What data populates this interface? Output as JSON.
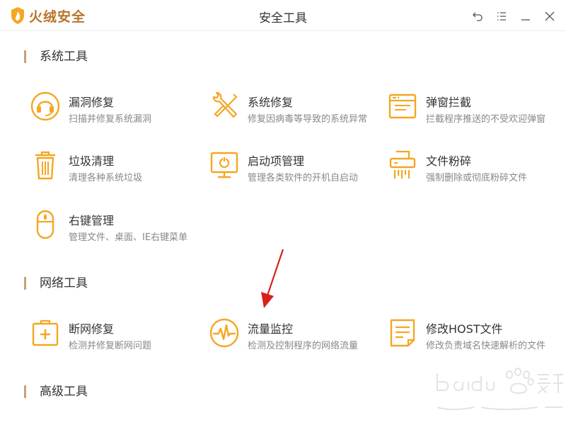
{
  "app": {
    "name": "火绒安全",
    "window_title": "安全工具",
    "brand_color": "#b8742a",
    "accent_color": "#f5a623"
  },
  "window_buttons": [
    {
      "icon": "back-icon"
    },
    {
      "icon": "menu-icon"
    },
    {
      "icon": "minimize-icon"
    },
    {
      "icon": "close-icon"
    }
  ],
  "sections": {
    "system": {
      "title": "系统工具",
      "tools": [
        {
          "name": "漏洞修复",
          "desc": "扫描并修复系统漏洞",
          "icon": "headset-shield-icon"
        },
        {
          "name": "系统修复",
          "desc": "修复因病毒等导致的系统异常",
          "icon": "wrench-screwdriver-icon"
        },
        {
          "name": "弹窗拦截",
          "desc": "拦截程序推送的不受欢迎弹窗",
          "icon": "popup-window-icon"
        },
        {
          "name": "垃圾清理",
          "desc": "清理各种系统垃圾",
          "icon": "trash-icon"
        },
        {
          "name": "启动项管理",
          "desc": "管理各类软件的开机自启动",
          "icon": "monitor-power-icon"
        },
        {
          "name": "文件粉碎",
          "desc": "强制删除或彻底粉碎文件",
          "icon": "shredder-icon"
        },
        {
          "name": "右键管理",
          "desc": "管理文件、桌面、IE右键菜单",
          "icon": "mouse-icon"
        }
      ]
    },
    "network": {
      "title": "网络工具",
      "tools": [
        {
          "name": "断网修复",
          "desc": "检测并修复断网问题",
          "icon": "first-aid-kit-icon"
        },
        {
          "name": "流量监控",
          "desc": "检测及控制程序的网络流量",
          "icon": "pulse-monitor-icon"
        },
        {
          "name": "修改HOST文件",
          "desc": "修改负责域名快速解析的文件",
          "icon": "document-edit-icon"
        }
      ]
    },
    "advanced": {
      "title": "高级工具"
    }
  }
}
